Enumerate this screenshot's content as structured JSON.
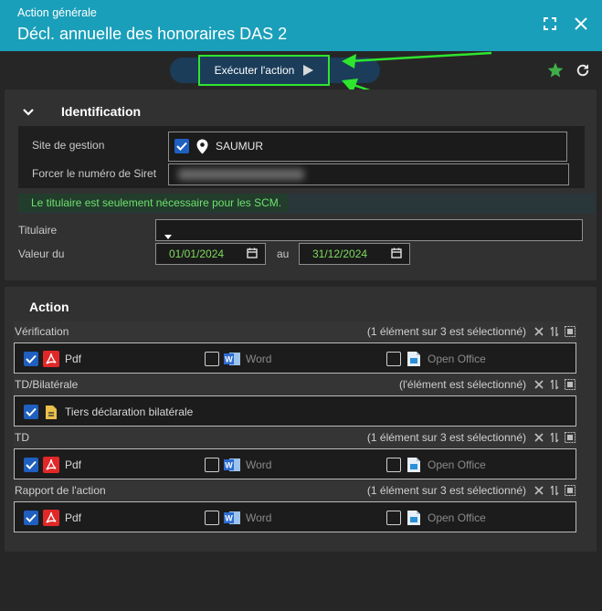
{
  "header": {
    "subtitle": "Action générale",
    "title": "Décl. annuelle des honoraires DAS 2"
  },
  "toolbar": {
    "execute_label": "Exécuter l'action"
  },
  "identification": {
    "title": "Identification",
    "site_label": "Site de gestion",
    "site_value": "SAUMUR",
    "siret_label": "Forcer le numéro de Siret",
    "note": "Le titulaire est seulement nécessaire pour les SCM.",
    "titulaire_label": "Titulaire",
    "valeur_label": "Valeur du",
    "date_from": "01/01/2024",
    "au_label": "au",
    "date_to": "31/12/2024"
  },
  "action": {
    "title": "Action",
    "groups": [
      {
        "name": "Vérification",
        "status": "(1 élément sur 3 est sélectionné)",
        "options": [
          {
            "label": "Pdf",
            "checked": true
          },
          {
            "label": "Word",
            "checked": false
          },
          {
            "label": "Open Office",
            "checked": false
          }
        ]
      },
      {
        "name": "TD/Bilatérale",
        "status": "(l'élément est sélectionné)",
        "options": [
          {
            "label": "Tiers déclaration bilatérale",
            "checked": true
          }
        ]
      },
      {
        "name": "TD",
        "status": "(1 élément sur 3 est sélectionné)",
        "options": [
          {
            "label": "Pdf",
            "checked": true
          },
          {
            "label": "Word",
            "checked": false
          },
          {
            "label": "Open Office",
            "checked": false
          }
        ]
      },
      {
        "name": "Rapport de l'action",
        "status": "(1 élément sur 3 est sélectionné)",
        "options": [
          {
            "label": "Pdf",
            "checked": true
          },
          {
            "label": "Word",
            "checked": false
          },
          {
            "label": "Open Office",
            "checked": false
          }
        ]
      }
    ]
  },
  "colors": {
    "header": "#1a9fba",
    "accent_green": "#2ee52e",
    "date_text": "#7ddc5c",
    "checkbox": "#1f5fbf"
  },
  "icons": [
    "fullscreen-icon",
    "close-icon",
    "play-icon",
    "star-icon",
    "refresh-icon",
    "chevron-down-icon",
    "location-pin-icon",
    "calendar-icon",
    "pdf-icon",
    "word-icon",
    "open-office-icon",
    "document-icon",
    "clear-icon",
    "sort-icon",
    "select-all-icon"
  ]
}
